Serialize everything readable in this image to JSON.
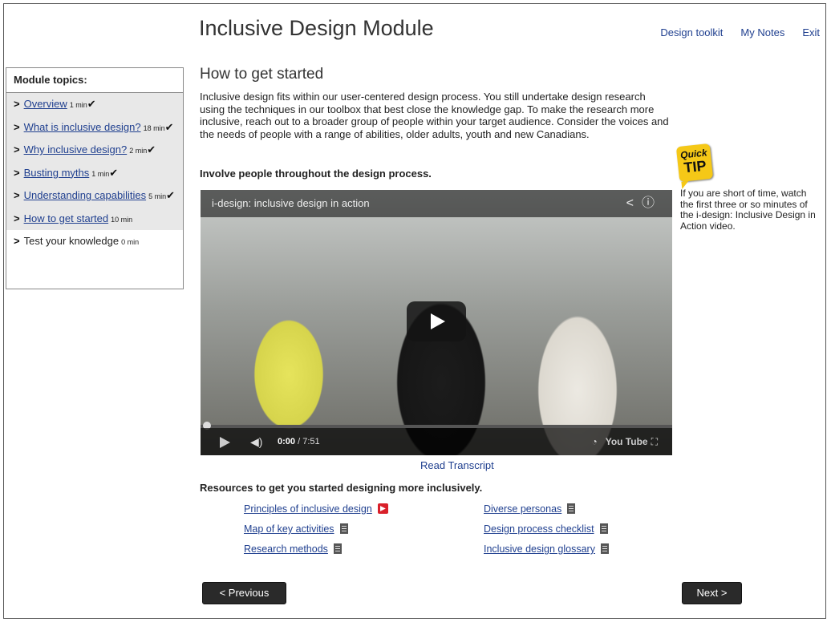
{
  "header": {
    "title": "Inclusive Design Module",
    "links": {
      "toolkit": "Design toolkit",
      "notes": "My Notes",
      "exit": "Exit"
    }
  },
  "sidebar": {
    "heading": "Module topics:",
    "arrow": ">",
    "items": [
      {
        "label": "Overview",
        "duration": "1 min",
        "check": "✔"
      },
      {
        "label": "What is inclusive design?",
        "duration": "18 min",
        "check": "✔"
      },
      {
        "label": "Why inclusive design?",
        "duration": "2 min",
        "check": "✔"
      },
      {
        "label": "Busting myths",
        "duration": "1 min",
        "check": "✔"
      },
      {
        "label": "Understanding capabilities",
        "duration": "5 min",
        "check": "✔"
      },
      {
        "label": "How to get started",
        "duration": "10 min",
        "check": ""
      },
      {
        "label": "Test your knowledge",
        "duration": "0 min",
        "check": ""
      }
    ]
  },
  "main": {
    "heading": "How to get started",
    "intro": "Inclusive design fits within our user-centered design process. You still undertake design research using the techniques in our toolbox that best close the knowledge gap. To make the research more inclusive, reach out to a broader group of people within your target audience. Consider the voices and the needs of people with a range of abilities, older adults, youth and new Canadians.",
    "involve": "Involve people throughout the design process."
  },
  "video": {
    "title": "i-design: inclusive design in action",
    "time_current": "0:00",
    "time_total": "/ 7:51",
    "youtube_label": "You Tube",
    "progress": 0
  },
  "transcript_link": "Read Transcript",
  "resources": {
    "title": "Resources to get you started designing more inclusively.",
    "left": [
      {
        "label": "Principles of inclusive design",
        "icon": "pdf-icon"
      },
      {
        "label": "Map of key activities",
        "icon": "document-icon"
      },
      {
        "label": "Research methods",
        "icon": "document-icon"
      }
    ],
    "right": [
      {
        "label": "Diverse personas",
        "icon": "document-icon"
      },
      {
        "label": "Design process checklist",
        "icon": "document-icon"
      },
      {
        "label": "Inclusive design glossary",
        "icon": "document-icon"
      }
    ]
  },
  "nav": {
    "previous": "< Previous",
    "next": "Next >"
  },
  "tip": {
    "badge_top": "Quick",
    "badge_bottom": "TIP",
    "text": "If you are short of time, watch the first three or so minutes of the i-design: Inclusive Design in Action video."
  },
  "colors": {
    "link": "#1f3f8f",
    "button": "#2a2a2a",
    "tip_badge": "#f5c817",
    "sidebar_bg": "#e8e8e8"
  }
}
